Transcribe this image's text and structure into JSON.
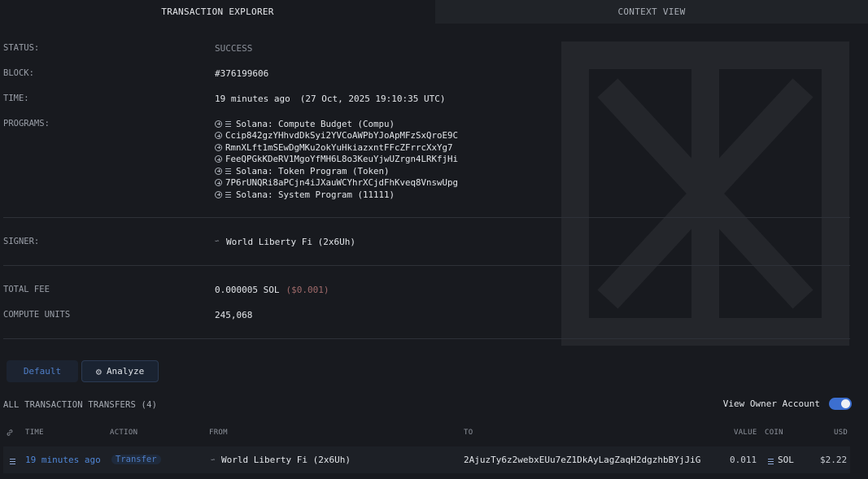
{
  "tabs": [
    {
      "label": "TRANSACTION EXPLORER",
      "active": true
    },
    {
      "label": "CONTEXT VIEW",
      "active": false
    }
  ],
  "details": {
    "status": {
      "label": "STATUS:",
      "value": "SUCCESS"
    },
    "block": {
      "label": "BLOCK:",
      "value": "#376199606"
    },
    "time": {
      "label": "TIME:",
      "value": "19 minutes ago",
      "exact": "(27 Oct, 2025 19:10:35 UTC)"
    },
    "programs": {
      "label": "PROGRAMS:",
      "items": [
        {
          "name": "Solana: Compute Budget (Compu)",
          "icon": "lines-icon"
        },
        {
          "name": "Ccip842gzYHhvdDkSyi2YVCoAWPbYJoApMFzSxQroE9C"
        },
        {
          "name": "RmnXLft1mSEwDgMKu2okYuHkiazxntFFcZFrrcXxYg7"
        },
        {
          "name": "FeeQPGkKDeRV1MgoYfMH6L8o3KeuYjwUZrgn4LRKfjHi"
        },
        {
          "name": "Solana: Token Program (Token)",
          "icon": "lines-icon"
        },
        {
          "name": "7P6rUNQRi8aPCjn4iJXauWCYhrXCjdFhKveq8VnswUpg"
        },
        {
          "name": "Solana: System Program (11111)",
          "icon": "lines-icon"
        }
      ]
    },
    "signer": {
      "label": "SIGNER:",
      "value": "World Liberty Fi (2x6Uh)"
    },
    "fee": {
      "label": "TOTAL FEE",
      "value": "0.000005 SOL",
      "usd": "($0.001)"
    },
    "compute": {
      "label": "COMPUTE UNITS",
      "value": "245,068"
    }
  },
  "modes": {
    "default_label": "Default",
    "analyze_label": "Analyze"
  },
  "transfers": {
    "title": "ALL TRANSACTION TRANSFERS (4)",
    "owner_toggle_label": "View Owner Account",
    "owner_toggle_on": true,
    "columns": {
      "time": "TIME",
      "action": "ACTION",
      "from": "FROM",
      "to": "TO",
      "value": "VALUE",
      "coin": "COIN",
      "usd": "USD"
    },
    "rows": [
      {
        "time": "19 minutes ago",
        "action": "Transfer",
        "from": "World Liberty Fi (2x6Uh)",
        "to": "2AjuzTy6z2webxEUu7eZ1DkAyLagZaqH2dgzhbBYjJiG",
        "value": "0.011",
        "coin": "SOL",
        "usd": "$2.22"
      }
    ]
  },
  "colors": {
    "accent": "#4f86d6",
    "background": "#181a1f",
    "toggle": "#3c6fd0"
  }
}
